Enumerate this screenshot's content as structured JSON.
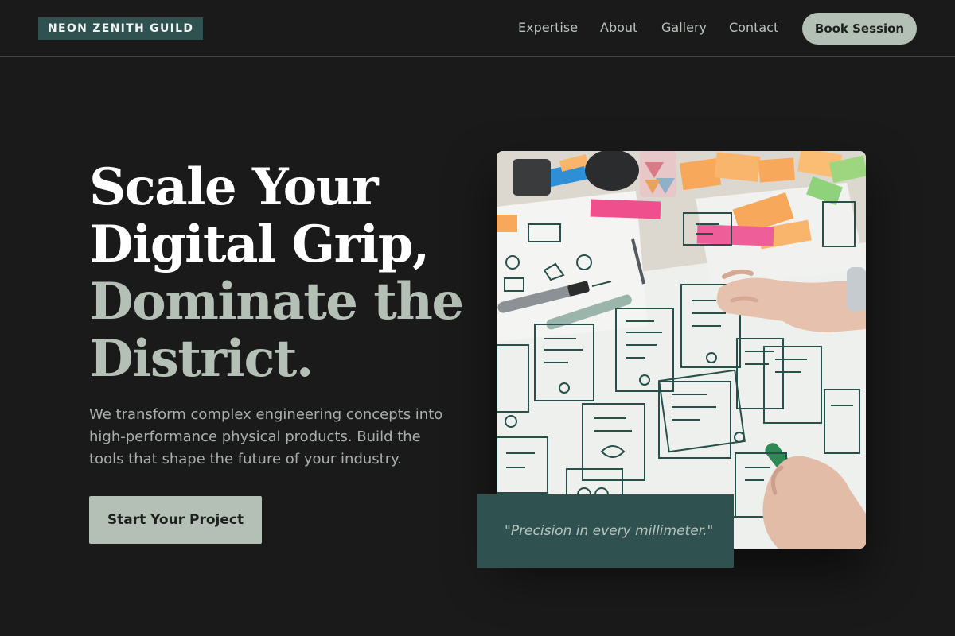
{
  "header": {
    "logo": "NEON ZENITH GUILD",
    "nav": [
      "Expertise",
      "About",
      "Gallery",
      "Contact"
    ],
    "cta_label": "Book Session"
  },
  "hero": {
    "headline_line1": "Scale Your",
    "headline_line2": "Digital Grip,",
    "headline_line3": "Dominate the",
    "headline_line4": "District.",
    "lead": "We transform complex engineering concepts into high-performance physical products. Build the tools that shape the future of your industry.",
    "cta_label": "Start Your Project"
  },
  "image_card": {
    "quote": "\"Precision in every millimeter.\""
  },
  "colors": {
    "background": "#1a1a1a",
    "accent_teal": "#2f5250",
    "sage": "#b4c0b6"
  }
}
